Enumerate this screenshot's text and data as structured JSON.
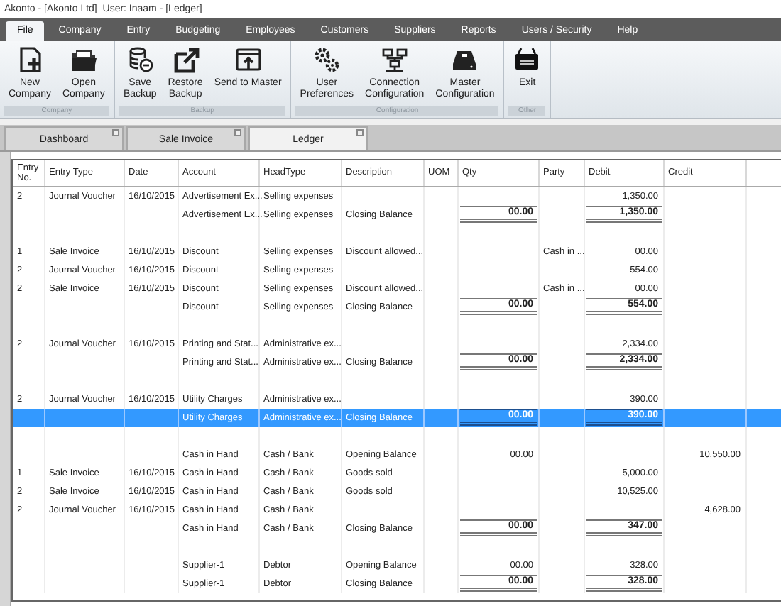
{
  "window": {
    "title": "Akonto - [Akonto Ltd]  User: Inaam - [Ledger]"
  },
  "menu": [
    {
      "label": "File",
      "selected": true
    },
    {
      "label": "Company",
      "selected": false
    },
    {
      "label": "Entry",
      "selected": false
    },
    {
      "label": "Budgeting",
      "selected": false
    },
    {
      "label": "Employees",
      "selected": false
    },
    {
      "label": "Customers",
      "selected": false
    },
    {
      "label": "Suppliers",
      "selected": false
    },
    {
      "label": "Reports",
      "selected": false
    },
    {
      "label": "Users / Security",
      "selected": false
    },
    {
      "label": "Help",
      "selected": false
    }
  ],
  "ribbon": [
    {
      "label": "Company",
      "buttons": [
        {
          "kind": "new",
          "label": "New\nCompany"
        },
        {
          "kind": "open",
          "label": "Open\nCompany"
        }
      ]
    },
    {
      "label": "Backup",
      "buttons": [
        {
          "kind": "save",
          "label": "Save\nBackup"
        },
        {
          "kind": "restore",
          "label": "Restore\nBackup"
        },
        {
          "kind": "send",
          "label": "Send to Master"
        }
      ]
    },
    {
      "label": "Configuration",
      "buttons": [
        {
          "kind": "gears",
          "label": "User\nPreferences"
        },
        {
          "kind": "network",
          "label": "Connection\nConfiguration"
        },
        {
          "kind": "drive",
          "label": "Master\nConfiguration"
        }
      ]
    },
    {
      "label": "Other",
      "buttons": [
        {
          "kind": "exit",
          "label": "Exit"
        }
      ]
    }
  ],
  "document_tabs": [
    {
      "label": "Dashboard",
      "selected": false
    },
    {
      "label": "Sale Invoice",
      "selected": false
    },
    {
      "label": "Ledger",
      "selected": true
    }
  ],
  "table": {
    "columns": [
      "Entry\nNo.",
      "Entry Type",
      "Date",
      "Account",
      "HeadType",
      "Description",
      "UOM",
      "Qty",
      "Party",
      "Debit",
      "Credit"
    ],
    "rows": [
      {
        "kind": "entry",
        "selected": false,
        "entry_no": "2",
        "entry_type": "Journal Voucher",
        "date": "16/10/2015",
        "account": "Advertisement Ex...",
        "head_type": "Selling expenses",
        "debit": "1,350.00"
      },
      {
        "kind": "total",
        "selected": false,
        "account": "Advertisement Ex...",
        "head_type": "Selling expenses",
        "description": "Closing Balance",
        "qty": "00.00",
        "debit": "1,350.00"
      },
      {
        "kind": "blank",
        "selected": false
      },
      {
        "kind": "entry",
        "selected": false,
        "entry_no": "1",
        "entry_type": "Sale Invoice",
        "date": "16/10/2015",
        "account": "Discount",
        "head_type": "Selling expenses",
        "description": "Discount allowed...",
        "party": "Cash in ...",
        "debit": "00.00"
      },
      {
        "kind": "entry",
        "selected": false,
        "entry_no": "2",
        "entry_type": "Journal Voucher",
        "date": "16/10/2015",
        "account": "Discount",
        "head_type": "Selling expenses",
        "debit": "554.00"
      },
      {
        "kind": "entry",
        "selected": false,
        "entry_no": "2",
        "entry_type": "Sale Invoice",
        "date": "16/10/2015",
        "account": "Discount",
        "head_type": "Selling expenses",
        "description": "Discount allowed...",
        "party": "Cash in ...",
        "debit": "00.00"
      },
      {
        "kind": "total",
        "selected": false,
        "account": "Discount",
        "head_type": "Selling expenses",
        "description": "Closing Balance",
        "qty": "00.00",
        "debit": "554.00"
      },
      {
        "kind": "blank",
        "selected": false
      },
      {
        "kind": "entry",
        "selected": false,
        "entry_no": "2",
        "entry_type": "Journal Voucher",
        "date": "16/10/2015",
        "account": "Printing and Stat...",
        "head_type": "Administrative ex...",
        "debit": "2,334.00"
      },
      {
        "kind": "total",
        "selected": false,
        "account": "Printing and Stat...",
        "head_type": "Administrative ex...",
        "description": "Closing Balance",
        "qty": "00.00",
        "debit": "2,334.00"
      },
      {
        "kind": "blank",
        "selected": false
      },
      {
        "kind": "entry",
        "selected": false,
        "entry_no": "2",
        "entry_type": "Journal Voucher",
        "date": "16/10/2015",
        "account": "Utility Charges",
        "head_type": "Administrative ex...",
        "debit": "390.00"
      },
      {
        "kind": "total",
        "selected": true,
        "account": "Utility Charges",
        "head_type": "Administrative ex...",
        "description": "Closing Balance",
        "qty": "00.00",
        "debit": "390.00"
      },
      {
        "kind": "blank",
        "selected": false
      },
      {
        "kind": "entry",
        "selected": false,
        "account": "Cash in Hand",
        "head_type": "Cash / Bank",
        "description": "Opening Balance",
        "qty": "00.00",
        "credit": "10,550.00"
      },
      {
        "kind": "entry",
        "selected": false,
        "entry_no": "1",
        "entry_type": "Sale Invoice",
        "date": "16/10/2015",
        "account": "Cash in Hand",
        "head_type": "Cash / Bank",
        "description": "Goods sold",
        "debit": "5,000.00"
      },
      {
        "kind": "entry",
        "selected": false,
        "entry_no": "2",
        "entry_type": "Sale Invoice",
        "date": "16/10/2015",
        "account": "Cash in Hand",
        "head_type": "Cash / Bank",
        "description": "Goods sold",
        "debit": "10,525.00"
      },
      {
        "kind": "entry",
        "selected": false,
        "entry_no": "2",
        "entry_type": "Journal Voucher",
        "date": "16/10/2015",
        "account": "Cash in Hand",
        "head_type": "Cash / Bank",
        "credit": "4,628.00"
      },
      {
        "kind": "total",
        "selected": false,
        "account": "Cash in Hand",
        "head_type": "Cash / Bank",
        "description": "Closing Balance",
        "qty": "00.00",
        "debit": "347.00"
      },
      {
        "kind": "blank",
        "selected": false
      },
      {
        "kind": "entry",
        "selected": false,
        "account": "Supplier-1",
        "head_type": "Debtor",
        "description": "Opening Balance",
        "qty": "00.00",
        "debit": "328.00"
      },
      {
        "kind": "total",
        "selected": false,
        "account": "Supplier-1",
        "head_type": "Debtor",
        "description": "Closing Balance",
        "qty": "00.00",
        "debit": "328.00"
      }
    ]
  }
}
